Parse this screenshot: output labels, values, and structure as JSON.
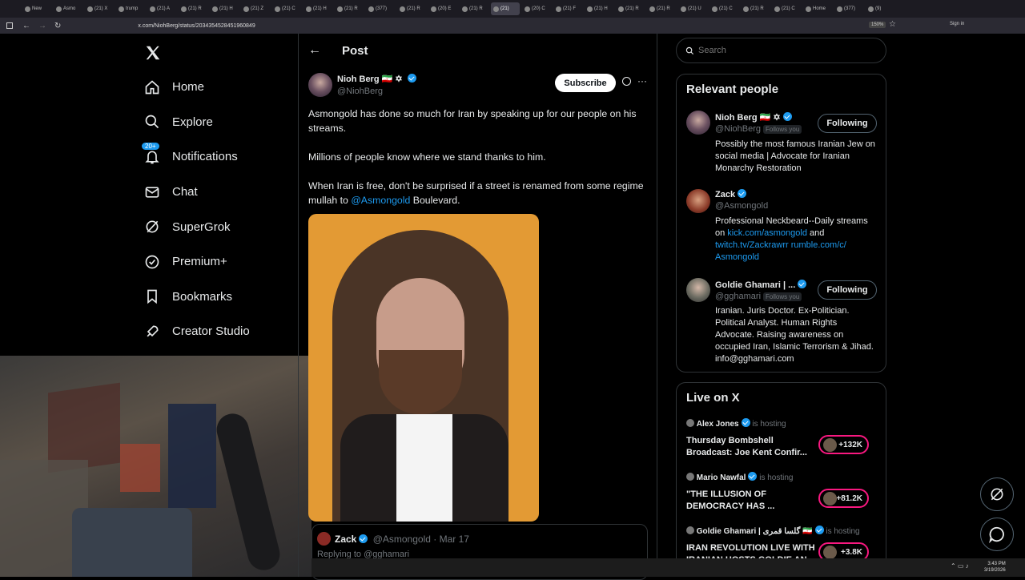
{
  "browser": {
    "tabs": [
      {
        "label": "New"
      },
      {
        "label": "Asmo"
      },
      {
        "label": "(21) X"
      },
      {
        "label": "trump"
      },
      {
        "label": "(21) A"
      },
      {
        "label": "(21) R"
      },
      {
        "label": "(21) H"
      },
      {
        "label": "(21) Z"
      },
      {
        "label": "(21) C"
      },
      {
        "label": "(21) H"
      },
      {
        "label": "(21) R"
      },
      {
        "label": "(377)"
      },
      {
        "label": "(21) R"
      },
      {
        "label": "(20) E"
      },
      {
        "label": "(21) R"
      },
      {
        "label": "(21)"
      },
      {
        "label": "(20) C"
      },
      {
        "label": "(21) F"
      },
      {
        "label": "(21) H"
      },
      {
        "label": "(21) R"
      },
      {
        "label": "(21) R"
      },
      {
        "label": "(21) U"
      },
      {
        "label": "(21) C"
      },
      {
        "label": "(21) R"
      },
      {
        "label": "(21) C"
      },
      {
        "label": "Home"
      },
      {
        "label": "(377)"
      },
      {
        "label": "(9)"
      }
    ],
    "active_tab_index": 15,
    "url": "x.com/NiohBerg/status/2034354528451960849",
    "zoom": "150%",
    "sign_in": "Sign in"
  },
  "left_nav": {
    "items": [
      {
        "label": "Home",
        "icon": "home-icon"
      },
      {
        "label": "Explore",
        "icon": "search-icon"
      },
      {
        "label": "Notifications",
        "icon": "bell-icon",
        "badge": "20+"
      },
      {
        "label": "Chat",
        "icon": "mail-icon"
      },
      {
        "label": "SuperGrok",
        "icon": "grok-icon"
      },
      {
        "label": "Premium+",
        "icon": "premium-icon"
      },
      {
        "label": "Bookmarks",
        "icon": "bookmark-icon"
      },
      {
        "label": "Creator Studio",
        "icon": "rocket-icon"
      }
    ]
  },
  "post": {
    "header_title": "Post",
    "author_name": "Nioh Berg",
    "author_flags": "🇮🇷 ✡",
    "author_handle": "@NiohBerg",
    "subscribe_label": "Subscribe",
    "paragraph1": "Asmongold has done so much for Iran by speaking up for our people on his streams.",
    "paragraph2": "Millions of people know where we stand thanks to him.",
    "paragraph3_before": "When Iran is free, don't be surprised if a street is renamed from some regime mullah to ",
    "paragraph3_mention": "@Asmongold",
    "paragraph3_after": " Boulevard.",
    "quoted": {
      "name": "Zack",
      "handle": "@Asmongold",
      "date": "· Mar 17",
      "replying": "Replying to @gghamari"
    }
  },
  "search": {
    "placeholder": "Search"
  },
  "relevant_people": {
    "title": "Relevant people",
    "people": [
      {
        "name": "Nioh Berg 🇮🇷 ✡",
        "handle": "@NiohBerg",
        "follows_you": "Follows you",
        "button": "Following",
        "bio": "Possibly the most famous Iranian Jew on social media | Advocate for Iranian Monarchy Restoration"
      },
      {
        "name": "Zack",
        "handle": "@Asmongold",
        "bio_prefix": "Professional Neckbeard--Daily streams on ",
        "bio_link1": "kick.com/asmongold",
        "bio_mid": " and ",
        "bio_link2": "twitch.tv/Zackrawrr rumble.com/c/ Asmongold"
      },
      {
        "name": "Goldie Ghamari | ...",
        "handle": "@gghamari",
        "follows_you": "Follows you",
        "button": "Following",
        "bio": "Iranian. Juris Doctor. Ex-Politician. Political Analyst. Human Rights Advocate. Raising awareness on occupied Iran, Islamic Terrorism & Jihad. info@gghamari.com"
      }
    ]
  },
  "live": {
    "title": "Live on X",
    "items": [
      {
        "host": "Alex Jones",
        "status": "is hosting",
        "title": "Thursday Bombshell Broadcast: Joe Kent Confir...",
        "count": "+132K"
      },
      {
        "host": "Mario Nawfal",
        "status": "is hosting",
        "title": "\"THE ILLUSION OF DEMOCRACY HAS ...",
        "count": "+81.2K"
      },
      {
        "host": "Goldie Ghamari | گلسا قمری 🇮🇷",
        "status": "is hosting",
        "title": "IRAN REVOLUTION LIVE WITH IRANIAN HOSTS GOLDIE AN...",
        "count": "+3.8K"
      }
    ]
  },
  "taskbar": {
    "time": "3:43 PM",
    "date": "3/19/2026"
  },
  "colors": {
    "accent": "#1d9bf0",
    "live": "#f91880",
    "background": "#000000"
  }
}
